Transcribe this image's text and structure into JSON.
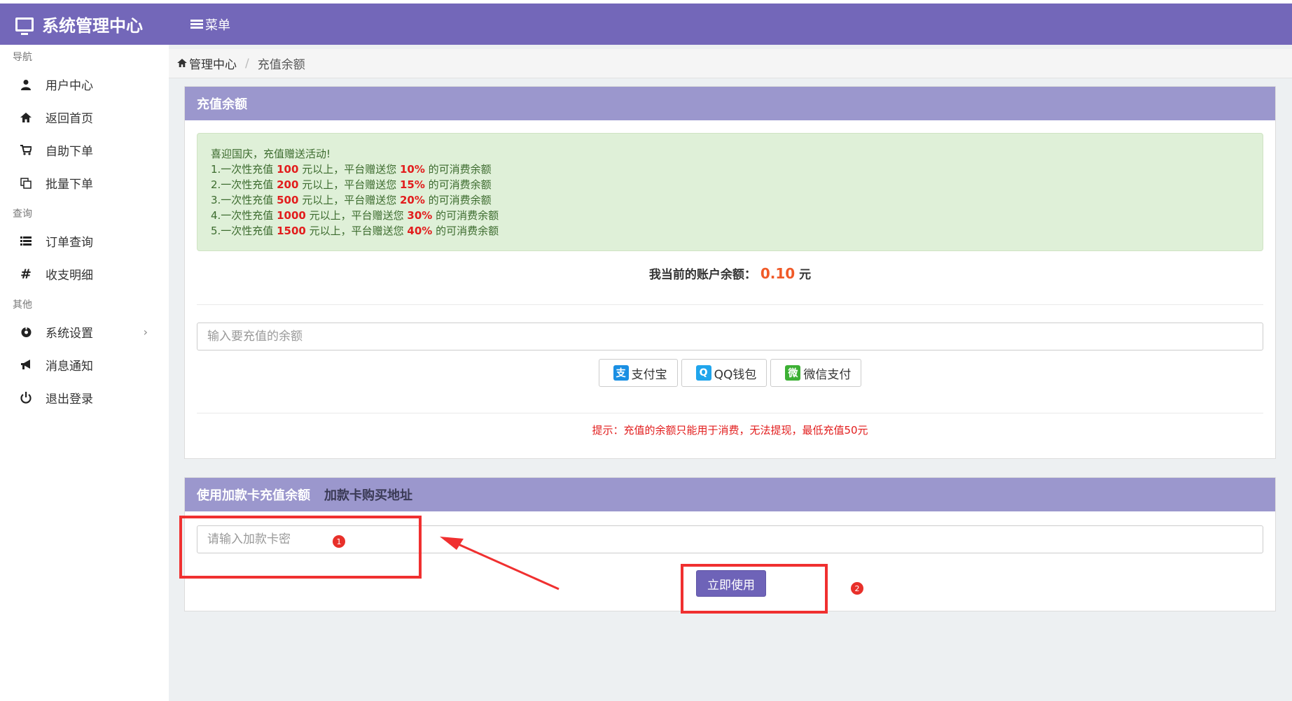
{
  "app": {
    "title": "系统管理中心",
    "menu_label": "菜单"
  },
  "sidebar": {
    "groups": [
      {
        "label": "导航",
        "items": [
          {
            "label": "用户中心",
            "icon": "user-icon"
          },
          {
            "label": "返回首页",
            "icon": "home-icon"
          },
          {
            "label": "自助下单",
            "icon": "cart-icon"
          },
          {
            "label": "批量下单",
            "icon": "copy-icon"
          }
        ]
      },
      {
        "label": "查询",
        "items": [
          {
            "label": "订单查询",
            "icon": "list-icon"
          },
          {
            "label": "收支明细",
            "icon": "hash-icon"
          }
        ]
      },
      {
        "label": "其他",
        "items": [
          {
            "label": "系统设置",
            "icon": "settings-icon",
            "has_arrow": true
          },
          {
            "label": "消息通知",
            "icon": "bullhorn-icon"
          },
          {
            "label": "退出登录",
            "icon": "power-icon"
          }
        ]
      }
    ]
  },
  "breadcrumb": {
    "home": "管理中心",
    "separator": "/",
    "current": "充值余额"
  },
  "recharge": {
    "title": "充值余额",
    "notice_title": "喜迎国庆，充值赠送活动!",
    "promos": [
      {
        "prefix": "1.一次性充值",
        "amount": "100",
        "mid": "元以上，平台赠送您",
        "pct": "10%",
        "suffix": "的可消费余额"
      },
      {
        "prefix": "2.一次性充值",
        "amount": "200",
        "mid": "元以上，平台赠送您",
        "pct": "15%",
        "suffix": "的可消费余额"
      },
      {
        "prefix": "3.一次性充值",
        "amount": "500",
        "mid": "元以上，平台赠送您",
        "pct": "20%",
        "suffix": "的可消费余额"
      },
      {
        "prefix": "4.一次性充值",
        "amount": "1000",
        "mid": "元以上，平台赠送您",
        "pct": "30%",
        "suffix": "的可消费余额"
      },
      {
        "prefix": "5.一次性充值",
        "amount": "1500",
        "mid": "元以上，平台赠送您",
        "pct": "40%",
        "suffix": "的可消费余额"
      }
    ],
    "balance_label": "我当前的账户余额：",
    "balance_value": "0.10",
    "balance_unit": "元",
    "amount_placeholder": "输入要充值的余额",
    "pay_methods": [
      {
        "label": "支付宝",
        "icon": "alipay-icon",
        "color": "#1a8fe3",
        "glyph": "支"
      },
      {
        "label": "QQ钱包",
        "icon": "qq-wallet-icon",
        "color": "#20a5ec",
        "glyph": "Q"
      },
      {
        "label": "微信支付",
        "icon": "wechat-pay-icon",
        "color": "#3cb034",
        "glyph": "微"
      }
    ],
    "tip": "提示：充值的余额只能用于消费，无法提现，最低充值50元"
  },
  "card": {
    "title": "使用加款卡充值余额",
    "buy_link": "加款卡购买地址",
    "placeholder": "请输入加款卡密",
    "submit_label": "立即使用"
  },
  "annotations": {
    "badge_1": "1",
    "badge_2": "2"
  },
  "colors": {
    "primary": "#7367b9",
    "panel_header": "#9b97cd",
    "highlight": "#e21d1d",
    "balance": "#f05a28",
    "notice_bg": "#dff0d8",
    "annotation": "#f03030"
  }
}
